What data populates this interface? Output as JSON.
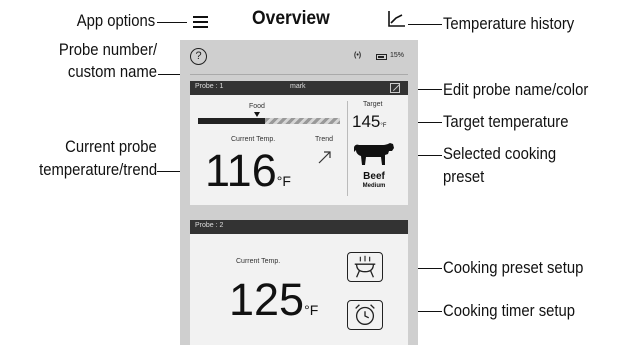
{
  "header": {
    "title": "Overview"
  },
  "callouts": {
    "app_options": "App options",
    "probe_number_line1": "Probe number/",
    "probe_number_line2": "custom name",
    "current_temp_line1": "Current probe",
    "current_temp_line2": "temperature/trend",
    "temperature_history": "Temperature history",
    "edit_probe": "Edit probe name/color",
    "target_temperature": "Target temperature",
    "selected_preset_line1": "Selected cooking",
    "selected_preset_line2": "preset",
    "preset_setup": "Cooking preset setup",
    "timer_setup": "Cooking timer setup"
  },
  "status_bar": {
    "help": "?",
    "signal": "(•)",
    "battery_percent": "15%",
    "battery_level": 0.15
  },
  "probe1": {
    "label": "Probe : 1",
    "custom_name": "mark",
    "food_label": "Food",
    "progress_fraction": 0.47,
    "current_temp_label": "Current Temp.",
    "trend_label": "Trend",
    "trend_direction": "rising",
    "current_temp": "116",
    "temp_unit": "°F",
    "target_label": "Target",
    "target_temp": "145",
    "target_unit": "°F",
    "preset_name": "Beef",
    "preset_doneness": "Medium",
    "preset_icon": "cow-icon"
  },
  "probe2": {
    "label": "Probe : 2",
    "current_temp_label": "Current Temp.",
    "current_temp": "125",
    "temp_unit": "°F"
  },
  "icons": {
    "app_options": "hamburger-menu-icon",
    "temperature_history": "line-chart-icon",
    "edit": "edit-icon",
    "preset": "grill-icon",
    "timer": "alarm-clock-icon"
  },
  "colors": {
    "screen_bg": "#cfcfcf",
    "card_bg": "#f2f2f2",
    "header_bar": "#333333"
  }
}
